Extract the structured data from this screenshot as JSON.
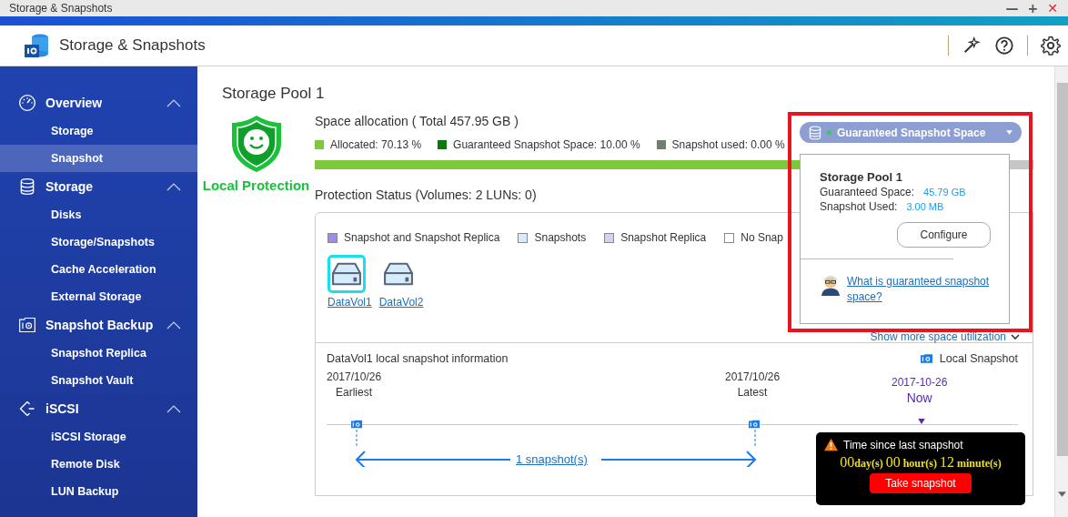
{
  "window": {
    "title": "Storage & Snapshots",
    "controls": [
      {
        "kind": "minimize",
        "label": "—"
      },
      {
        "kind": "maximize",
        "label": "+"
      },
      {
        "kind": "close",
        "label": "✕"
      }
    ]
  },
  "header": {
    "title": "Storage & Snapshots"
  },
  "sidebar": {
    "groups": [
      {
        "label": "Overview",
        "expanded": true,
        "items": [
          {
            "label": "Storage",
            "selected": false
          },
          {
            "label": "Snapshot",
            "selected": true
          }
        ]
      },
      {
        "label": "Storage",
        "expanded": true,
        "items": [
          {
            "label": "Disks",
            "selected": false
          },
          {
            "label": "Storage/Snapshots",
            "selected": false
          },
          {
            "label": "Cache Acceleration",
            "selected": false
          },
          {
            "label": "External Storage",
            "selected": false
          }
        ]
      },
      {
        "label": "Snapshot Backup",
        "expanded": true,
        "items": [
          {
            "label": "Snapshot Replica",
            "selected": false
          },
          {
            "label": "Snapshot Vault",
            "selected": false
          }
        ]
      },
      {
        "label": "iSCSI",
        "expanded": true,
        "items": [
          {
            "label": "iSCSI Storage",
            "selected": false
          },
          {
            "label": "Remote Disk",
            "selected": false
          },
          {
            "label": "LUN Backup",
            "selected": false
          }
        ]
      }
    ]
  },
  "page": {
    "title": "Storage Pool 1",
    "status": "Local Protection",
    "space": {
      "title": "Space allocation ( Total 457.95 GB )",
      "legend": [
        {
          "label": "Allocated: 70.13 %",
          "color": "#7dc83c",
          "level": 0.7013
        },
        {
          "label": "Guaranteed Snapshot Space: 10.00 %",
          "color": "#0a7a0a"
        },
        {
          "label": "Snapshot used: 0.00 %",
          "color": "#6f7f72"
        }
      ]
    },
    "protection": {
      "title": "Protection Status (Volumes: 2 LUNs: 0)",
      "legend": [
        {
          "label": "Snapshot and Snapshot Replica",
          "color": "#9a8cf0"
        },
        {
          "label": "Snapshots",
          "color": "#d4ecfb"
        },
        {
          "label": "Snapshot Replica",
          "color": "#d6cff7"
        },
        {
          "label": "No Snap",
          "color": "#ffffff"
        }
      ],
      "volumes": [
        {
          "label": "DataVol1",
          "selected": true
        },
        {
          "label": "DataVol2",
          "selected": false
        }
      ],
      "more_link": "Show more space utilization"
    },
    "snapshot_info": {
      "title": "DataVol1 local snapshot information",
      "legend": "Local Snapshot",
      "earliest": {
        "date": "2017/10/26",
        "label": "Earliest"
      },
      "latest": {
        "date": "2017/10/26",
        "label": "Latest"
      },
      "now": {
        "date": "2017-10-26",
        "label": "Now"
      },
      "count_link": "1 snapshot(s)",
      "tooltip": {
        "title": "Time since last snapshot",
        "days": "00",
        "days_unit": "day(s)",
        "hours": "00",
        "hours_unit": "hour(s)",
        "minutes": "12",
        "minutes_unit": "minute(s)",
        "button": "Take snapshot"
      }
    }
  },
  "dropdown": {
    "label": "Guaranteed Snapshot Space"
  },
  "popover": {
    "title": "Storage Pool 1",
    "rows": [
      {
        "label": "Guaranteed Space:",
        "value": "45.79 GB"
      },
      {
        "label": "Snapshot Used:",
        "value": "3.00 MB"
      }
    ],
    "button": "Configure",
    "help_link": "What is guaranteed snapshot space?"
  }
}
